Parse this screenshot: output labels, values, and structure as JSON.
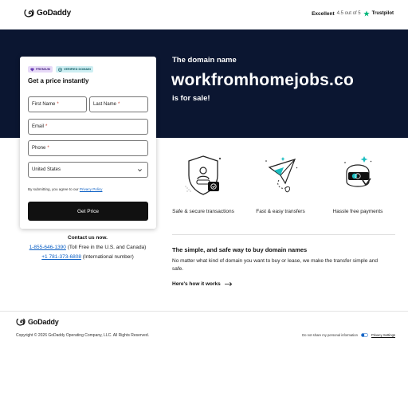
{
  "header": {
    "brand": "GoDaddy",
    "trust_rating_label": "Excellent",
    "trust_score": "4.5 out of 5",
    "trust_brand": "Trustpilot"
  },
  "hero": {
    "pre": "The domain name",
    "domain": "workfromhomejobs.co",
    "post": "is for sale!"
  },
  "form": {
    "badge_premium": "PREMIUM",
    "badge_verified": "VERIFIED DOMAIN",
    "title": "Get a price instantly",
    "first_name_label": "First Name",
    "last_name_label": "Last Name",
    "email_label": "Email",
    "phone_label": "Phone",
    "required_mark": "*",
    "country_value": "United States",
    "terms_prefix": "By submitting, you agree to our",
    "terms_link": "Privacy Policy",
    "submit_label": "Get Price"
  },
  "contact": {
    "title": "Contact us now.",
    "phone1": "1-855-646-1390",
    "phone1_note": "(Toll Free in the U.S. and Canada)",
    "phone2": "+1 781-373-6808",
    "phone2_note": "(International number)"
  },
  "features": [
    {
      "label": "Safe & secure transactions",
      "icon": "shield-icon"
    },
    {
      "label": "Fast & easy transfers",
      "icon": "paper-plane-icon"
    },
    {
      "label": "Hassle free payments",
      "icon": "payment-icon"
    }
  ],
  "info": {
    "title": "The simple, and safe way to buy domain names",
    "body": "No matter what kind of domain you want to buy or lease, we make the transfer simple and safe.",
    "link": "Here's how it works"
  },
  "footer": {
    "brand": "GoDaddy",
    "copyright": "Copyright © 2026 GoDaddy Operating Company, LLC. All Rights Reserved.",
    "do_not_share": "Do not share my personal information",
    "privacy": "Privacy Settings"
  },
  "colors": {
    "hero_bg": "#0b1631",
    "accent_teal": "#1bbdc0",
    "trustpilot_green": "#00b67a",
    "link_blue": "#0b5fc4"
  }
}
